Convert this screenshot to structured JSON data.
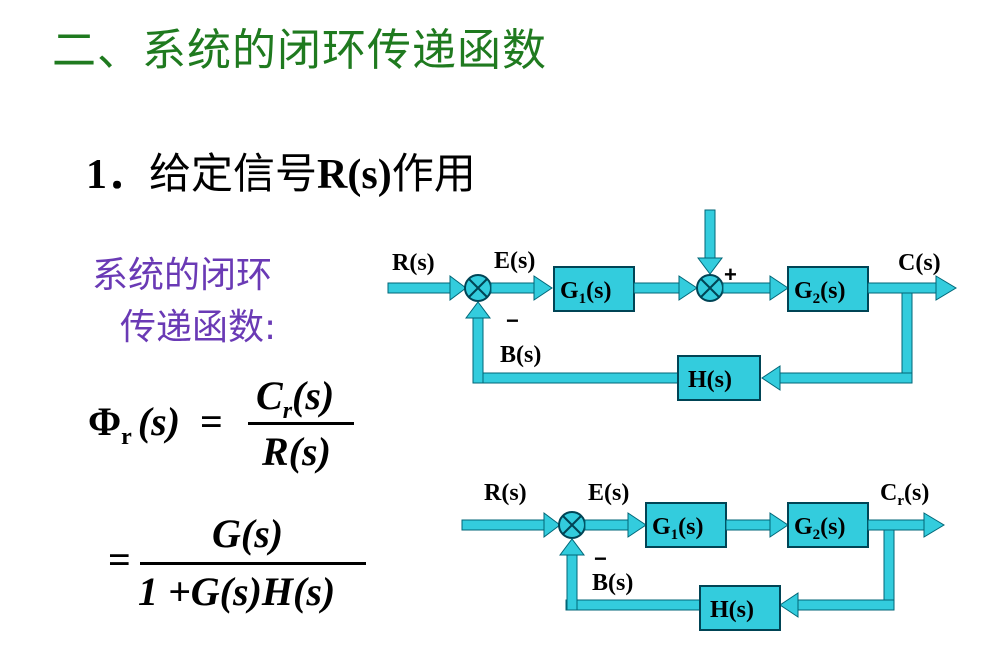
{
  "title": "二、系统的闭环传递函数",
  "subtitle": {
    "number": "1．",
    "text_before": "给定信号",
    "signal": "R(s)",
    "text_after": "作用"
  },
  "description": {
    "line1": "系统的闭环",
    "line2": "传递函数:"
  },
  "formula": {
    "lhs_symbol": "Φ",
    "lhs_sub": "r",
    "lhs_arg": "(s)",
    "eq1": "=",
    "num1_c": "C",
    "num1_sub": "r",
    "num1_arg": "(s)",
    "den1": "R(s)",
    "eq2": "=",
    "num2": "G(s)",
    "den2": "1 +G(s)H(s)"
  },
  "diagram1": {
    "input_label": "R(s)",
    "error_label": "E(s)",
    "feedback_label": "B(s)",
    "output_label": "C(s)",
    "g1_label": "G",
    "g1_sub": "1",
    "g1_arg": "(s)",
    "g2_label": "G",
    "g2_sub": "2",
    "g2_arg": "(s)",
    "h_label": "H(s)",
    "minus_sign": "−",
    "plus_sign": "+"
  },
  "diagram2": {
    "input_label": "R(s)",
    "error_label": "E(s)",
    "feedback_label": "B(s)",
    "output_c": "C",
    "output_sub": "r",
    "output_arg": "(s)",
    "g1_label": "G",
    "g1_sub": "1",
    "g1_arg": "(s)",
    "g2_label": "G",
    "g2_sub": "2",
    "g2_arg": "(s)",
    "h_label": "H(s)",
    "minus_sign": "−"
  },
  "colors": {
    "title_green": "#1f7a1f",
    "description_purple": "#6a3ab5",
    "block_fill": "#33ccdd",
    "line_cyan": "#33ccdd",
    "outline": "#006677"
  }
}
